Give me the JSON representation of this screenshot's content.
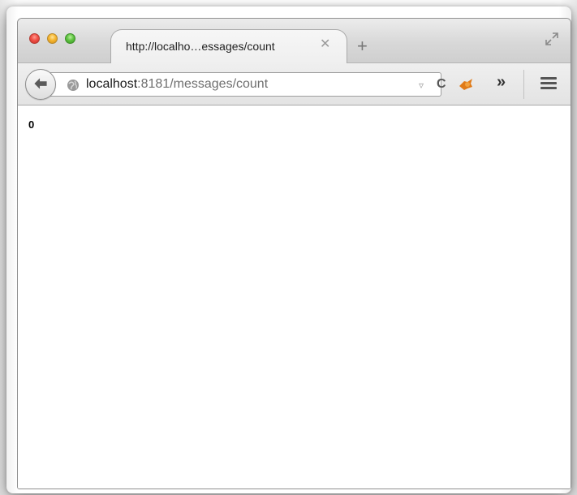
{
  "tab": {
    "title": "http://localho…essages/count",
    "close_label": "✕",
    "new_tab_label": "+"
  },
  "address": {
    "host": "localhost",
    "rest": ":8181/messages/count",
    "dropmarker": "▿",
    "reload": "C"
  },
  "toolbar": {
    "overflow_label": "»"
  },
  "page": {
    "content": "0"
  },
  "icons": {
    "back": "back-arrow-icon",
    "globe": "globe-icon",
    "extension": "extension-icon",
    "menu": "hamburger-menu-icon",
    "fullscreen": "fullscreen-icon"
  },
  "colors": {
    "close": "#f14f45",
    "minimize": "#f5b52f",
    "maximize": "#5fc341"
  }
}
